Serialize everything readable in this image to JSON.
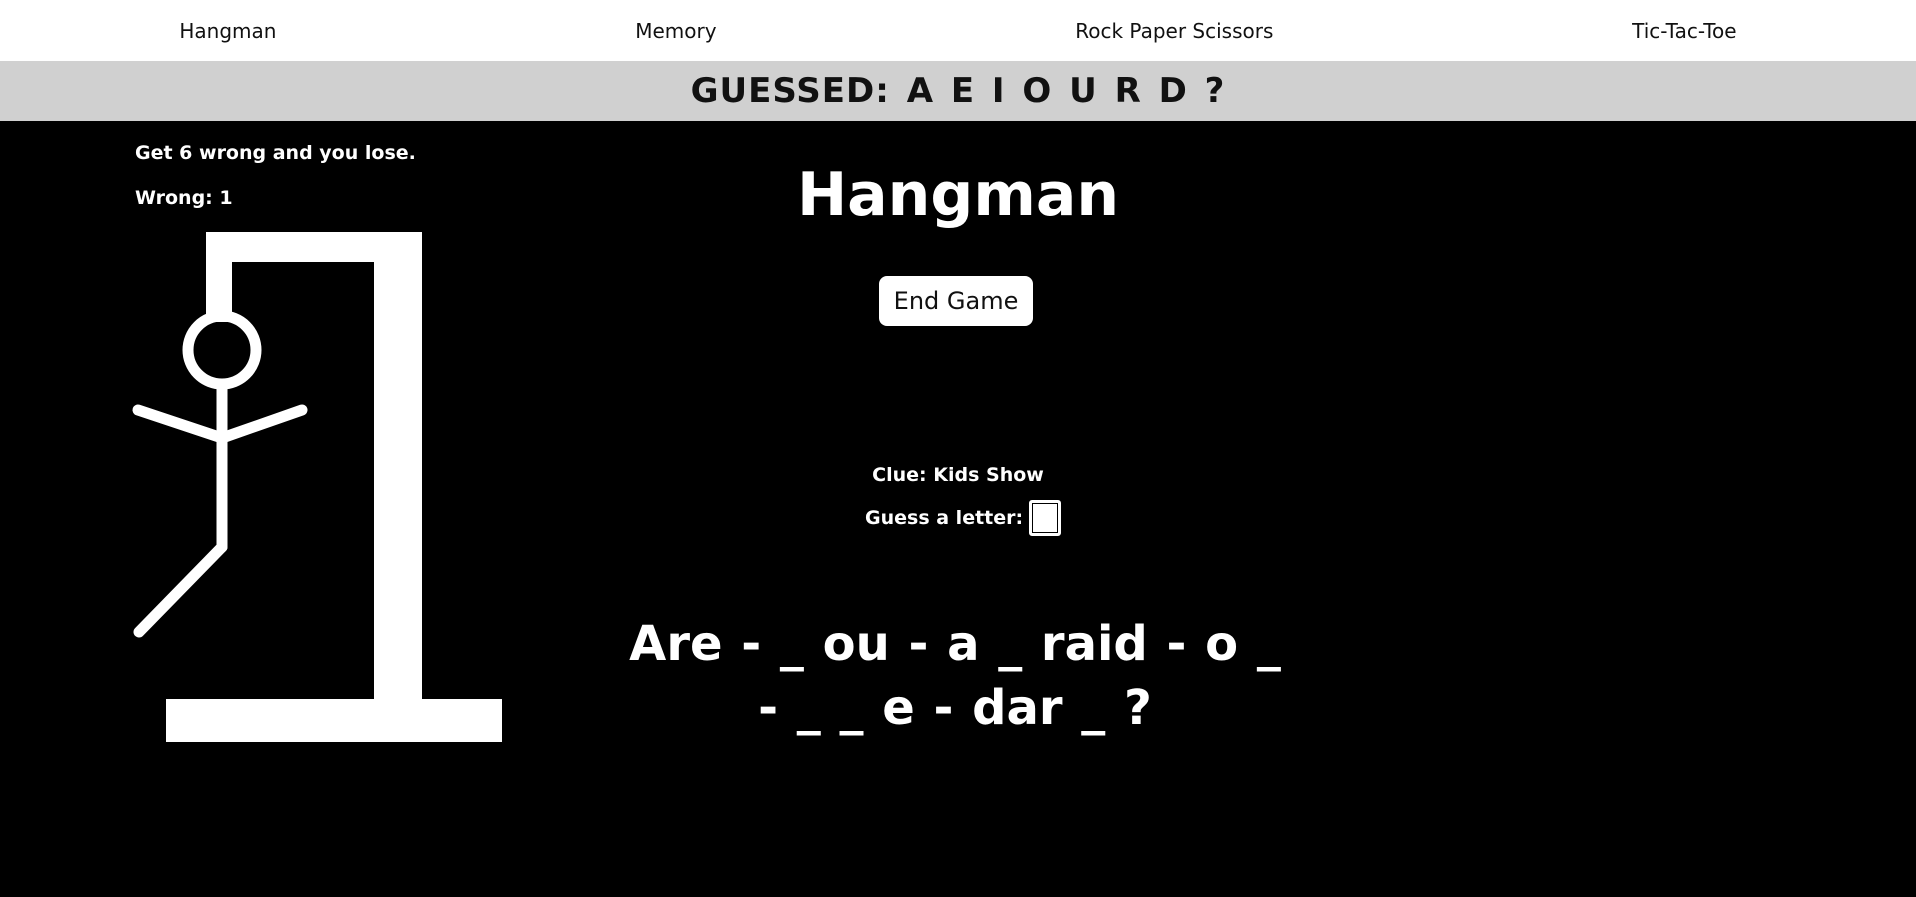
{
  "nav": {
    "items": [
      {
        "label": "Hangman"
      },
      {
        "label": "Memory"
      },
      {
        "label": "Rock Paper Scissors"
      },
      {
        "label": "Tic-Tac-Toe"
      }
    ]
  },
  "guessed": {
    "label": "GUESSED:",
    "letters": "A E I O U R D ?"
  },
  "status": {
    "rule": "Get 6 wrong and you lose.",
    "wrong_label": "Wrong:",
    "wrong_count": "1"
  },
  "game": {
    "title": "Hangman",
    "end_button": "End Game",
    "clue_label": "Clue:",
    "clue_value": "Kids Show",
    "guess_label": "Guess a letter:",
    "guess_value": "",
    "puzzle_line1": "Are - _ ou - a _ raid - o _",
    "puzzle_line2": "- _ _ e - dar _ ?"
  },
  "colors": {
    "background": "#000000",
    "nav_bg": "#ffffff",
    "guessed_bar_bg": "#d0d0d0",
    "drawing": "#ffffff"
  }
}
